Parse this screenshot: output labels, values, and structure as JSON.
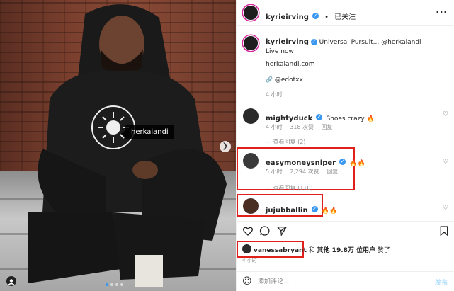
{
  "photo": {
    "tag_label": "herkaiandi",
    "next_icon": "chevron-right-icon"
  },
  "header": {
    "username": "kyrieirving",
    "separator": "•",
    "follow_label": "已关注",
    "more_icon": "ellipsis-icon"
  },
  "caption": {
    "username": "kyrieirving",
    "text": "Universal Pursuit... @herkaiandi",
    "line2": "Live now",
    "link": "herkaiandi.com",
    "credit": "@edotxx",
    "time": "4 小时"
  },
  "comments": [
    {
      "username": "mightyduck",
      "text": "Shoes crazy 🔥",
      "time": "4 小时",
      "likes": "318 次赞",
      "reply_label": "回复",
      "view_replies": "— 查看回复 (2)"
    },
    {
      "username": "easymoneysniper",
      "text": "🔥🔥",
      "time": "5 小时",
      "likes": "2,294 次赞",
      "reply_label": "回复",
      "view_replies": "— 查看回复 (110)"
    },
    {
      "username": "jujubballin",
      "text": "🔥🔥"
    }
  ],
  "likes_line": {
    "username": "vanessabryant",
    "and": "和",
    "others": "其他 19.8万 位用户",
    "suffix": "赞了"
  },
  "post_time": "4 小时",
  "add_comment_placeholder": "添加评论...",
  "post_label": "发布",
  "colors": {
    "accent": "#3897f0",
    "highlight_box": "#e0201a"
  }
}
